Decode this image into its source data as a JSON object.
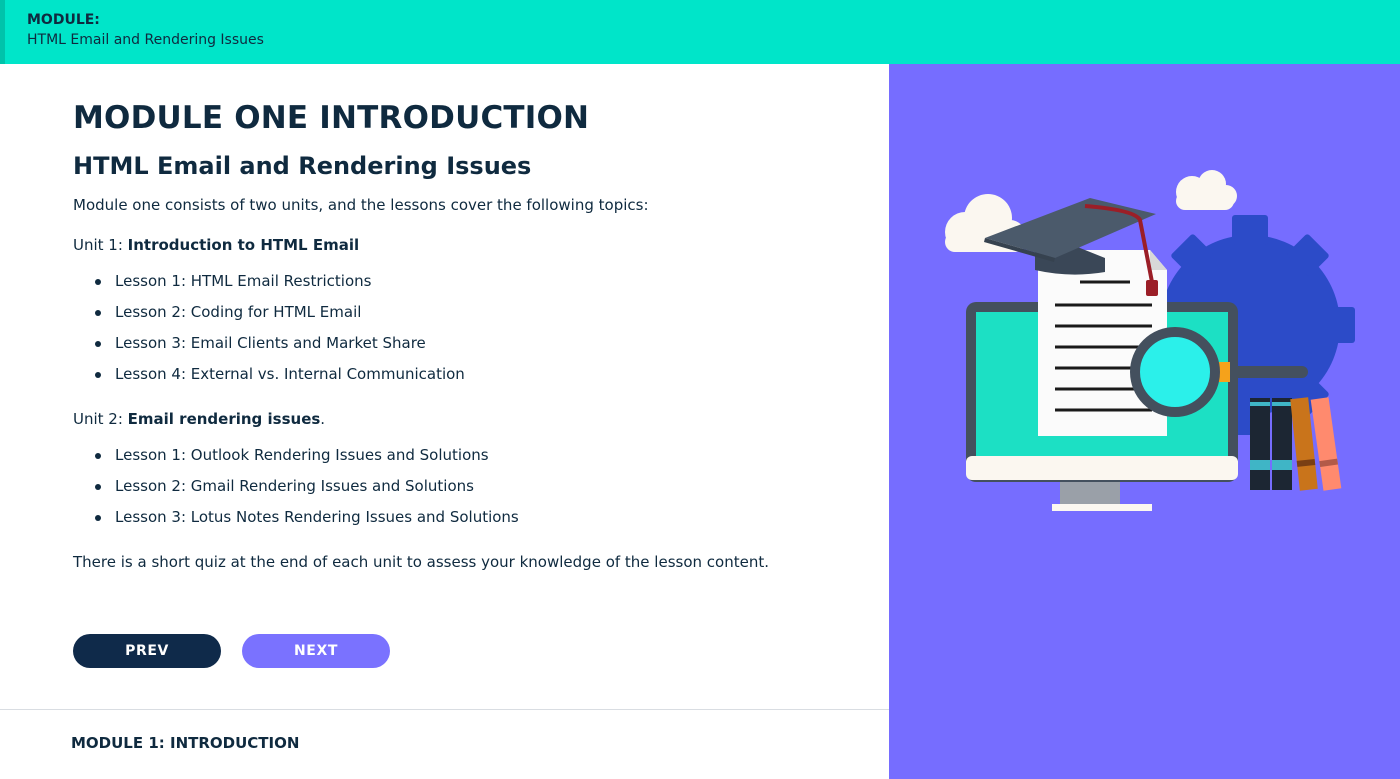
{
  "header": {
    "module_label": "MODULE:",
    "module_title": "HTML Email and Rendering Issues",
    "bg_color": "#00e5c9"
  },
  "main": {
    "title": "MODULE ONE INTRODUCTION",
    "subtitle": "HTML Email and Rendering Issues",
    "intro": "Module one consists of two units, and the lessons cover the following topics:",
    "units": [
      {
        "prefix": "Unit 1: ",
        "name": "Introduction to HTML Email",
        "suffix": "",
        "lessons": [
          "Lesson 1: HTML Email Restrictions",
          "Lesson 2: Coding for HTML Email",
          "Lesson 3: Email Clients and Market Share",
          "Lesson 4: External vs. Internal Communication"
        ]
      },
      {
        "prefix": "Unit 2: ",
        "name": "Email rendering issues",
        "suffix": ".",
        "lessons": [
          "Lesson 1: Outlook Rendering Issues and Solutions",
          "Lesson 2: Gmail Rendering Issues and Solutions",
          "Lesson 3: Lotus Notes Rendering Issues and Solutions"
        ]
      }
    ],
    "quiz_note": "There is a short quiz at the end of each unit to assess your knowledge of the lesson content."
  },
  "nav": {
    "prev_label": "PREV",
    "next_label": "NEXT",
    "prev_color": "#0f2a4a",
    "next_color": "#7a72ff"
  },
  "footer": {
    "label": "MODULE 1: INTRODUCTION"
  },
  "illustration": {
    "icons": [
      "cloud-icon",
      "graduation-cap-icon",
      "gear-icon",
      "monitor-icon",
      "document-icon",
      "magnifier-icon",
      "books-icon"
    ],
    "panel_color": "#766dff"
  }
}
